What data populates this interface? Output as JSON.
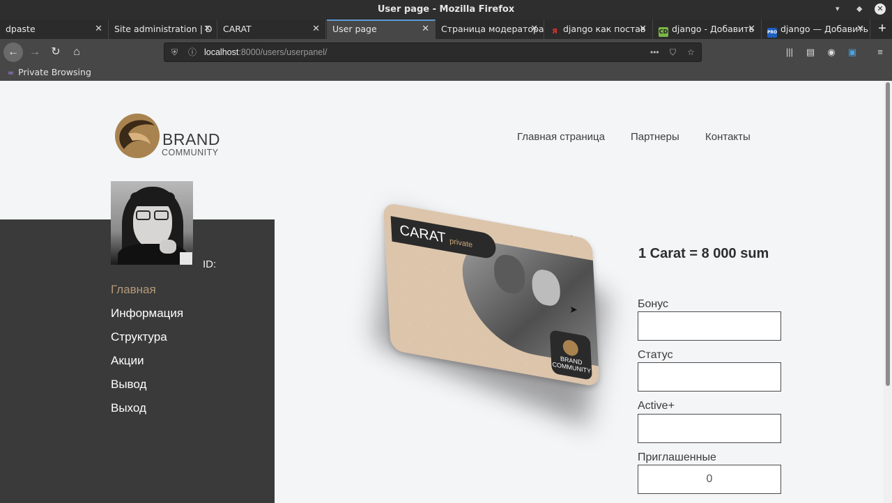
{
  "window": {
    "title": "User page - Mozilla Firefox",
    "min": "▾",
    "max": "◆",
    "close": "✕"
  },
  "tabs": [
    {
      "label": "dpaste",
      "icon": ""
    },
    {
      "label": "Site administration | D",
      "icon": ""
    },
    {
      "label": "CARAT",
      "icon": ""
    },
    {
      "label": "User page",
      "icon": "",
      "active": true
    },
    {
      "label": "Страница модератора",
      "icon": ""
    },
    {
      "label": "django как постав",
      "icon": "Я"
    },
    {
      "label": "django - Добавить",
      "icon": "CD"
    },
    {
      "label": "django — Добавить",
      "icon": "PRO"
    }
  ],
  "url": {
    "host": "localhost",
    "path": ":8000/users/userpanel/"
  },
  "private_browsing": "Private Browsing",
  "logo": {
    "line1": "BRAND",
    "line2": "COMMUNITY"
  },
  "topnav": [
    "Главная страница",
    "Партнеры",
    "Контакты"
  ],
  "user": {
    "id_label": "ID:"
  },
  "menu": [
    "Главная",
    "Информация",
    "Структура",
    "Акции",
    "Вывод",
    "Выход"
  ],
  "card": {
    "brand": "CARAT",
    "tier": "private",
    "logo_text": "BRAND COMMUNITY"
  },
  "rate": "1 Carat = 8 000 sum",
  "fields": [
    {
      "label": "Бонус",
      "value": ""
    },
    {
      "label": "Статус",
      "value": ""
    },
    {
      "label": "Active+",
      "value": ""
    },
    {
      "label": "Приглашенные",
      "value": "0"
    }
  ],
  "colors": {
    "menu_active": "#b59a79",
    "sidebar": "#3a3a3a",
    "accent_tab": "#5b9bd5"
  }
}
